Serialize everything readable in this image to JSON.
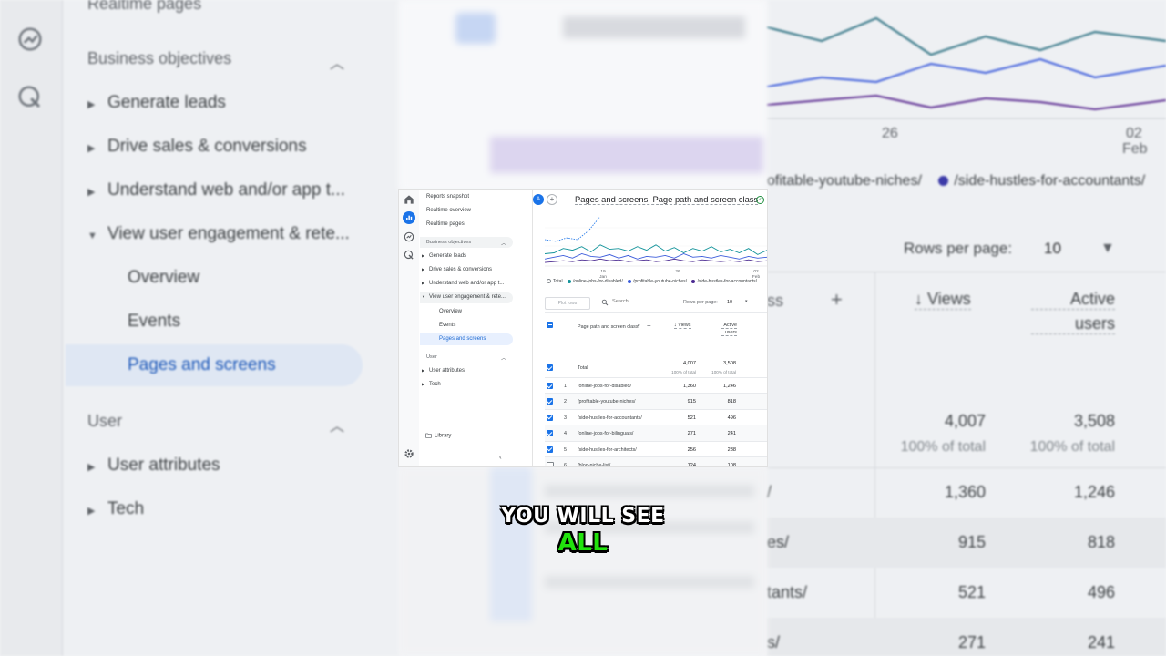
{
  "nav": {
    "top_items": [
      "Reports snapshot",
      "Realtime overview",
      "Realtime pages"
    ],
    "business_objectives": {
      "label": "Business objectives",
      "items": [
        "Generate leads",
        "Drive sales & conversions",
        "Understand web and/or app t...",
        "View user engagement & rete..."
      ],
      "subitems": [
        "Overview",
        "Events",
        "Pages and screens"
      ]
    },
    "user": {
      "label": "User",
      "items": [
        "User attributes",
        "Tech"
      ]
    },
    "library": "Library"
  },
  "bg_nav": {
    "realtime_pages": "Realtime pages",
    "business_objectives": "Business objectives",
    "items": [
      "Generate leads",
      "Drive sales & conversions",
      "Understand web and/or app t...",
      "View user engagement & rete..."
    ],
    "subitems": [
      "Overview",
      "Events",
      "Pages and screens"
    ],
    "user": "User",
    "user_items": [
      "User attributes",
      "Tech"
    ]
  },
  "header": {
    "avatar": "A",
    "plus": "+",
    "title": "Pages and screens: Page path and screen class"
  },
  "chart_data": {
    "type": "line",
    "x_ticks": [
      {
        "label": "19",
        "sub": "Jan"
      },
      {
        "label": "26",
        "sub": ""
      },
      {
        "label": "02",
        "sub": "Feb"
      }
    ],
    "series": [
      {
        "name": "Total",
        "color": "#1a73e8",
        "dashed": true,
        "values": [
          30,
          28,
          32,
          30,
          40,
          55
        ]
      },
      {
        "name": "/online-jobs-for-disabled/",
        "color": "#12939a",
        "values": [
          14,
          15,
          20,
          18,
          22,
          16,
          24,
          19,
          20,
          17,
          22,
          18,
          24,
          17,
          21,
          15,
          20,
          17,
          22,
          16,
          19,
          15,
          20,
          13,
          18
        ]
      },
      {
        "name": "/profitable-youtube-niches/",
        "color": "#3b5bdb",
        "values": [
          8,
          10,
          12,
          9,
          14,
          11,
          10,
          13,
          9,
          12,
          8,
          11,
          10,
          12,
          9,
          14,
          10,
          11,
          9,
          12,
          10,
          8,
          11,
          9,
          10
        ]
      },
      {
        "name": "/side-hustles-for-accountants/",
        "color": "#4b2a91",
        "values": [
          4,
          5,
          6,
          5,
          7,
          6,
          8,
          6,
          7,
          5,
          6,
          7,
          5,
          6,
          8,
          6,
          5,
          7,
          6,
          5,
          6,
          5,
          7,
          5,
          6
        ]
      }
    ]
  },
  "legend": [
    "Total",
    "/online-jobs-for-disabled/",
    "/profitable-youtube-niches/",
    "/side-hustles-for-accountants/"
  ],
  "toolbar": {
    "plot_rows": "Plot rows",
    "search_placeholder": "Search...",
    "rows_per_page_label": "Rows per page:",
    "rows_per_page_value": "10"
  },
  "table": {
    "col_dimension": "Page path and screen class",
    "col_views": "Views",
    "col_active_users_1": "Active",
    "col_active_users_2": "users",
    "total": {
      "label": "Total",
      "views": "4,007",
      "views_sub": "100% of total",
      "users": "3,508",
      "users_sub": "100% of total"
    },
    "rows": [
      {
        "idx": "1",
        "path": "/online-jobs-for-disabled/",
        "views": "1,360",
        "users": "1,246",
        "checked": true
      },
      {
        "idx": "2",
        "path": "/profitable-youtube-niches/",
        "views": "915",
        "users": "818",
        "checked": true
      },
      {
        "idx": "3",
        "path": "/side-hustles-for-accountants/",
        "views": "521",
        "users": "496",
        "checked": true
      },
      {
        "idx": "4",
        "path": "/online-jobs-for-bilinguals/",
        "views": "271",
        "users": "241",
        "checked": true
      },
      {
        "idx": "5",
        "path": "/side-hustles-for-architects/",
        "views": "256",
        "users": "238",
        "checked": true
      },
      {
        "idx": "6",
        "path": "/blog-niche-list/",
        "views": "124",
        "users": "108",
        "checked": false
      }
    ]
  },
  "bg_right": {
    "tick_26": "26",
    "tick_02": "02",
    "tick_feb": "Feb",
    "legend_a": "ofitable-youtube-niches/",
    "legend_b": "/side-hustles-for-accountants/",
    "rows_per_page_label": "Rows per page:",
    "rows_per_page_value": "10",
    "col_frag": "ss",
    "views": "Views",
    "active": "Active",
    "users": "users",
    "total_views": "4,007",
    "total_users": "3,508",
    "pct": "100% of total",
    "frags": [
      "/",
      "es/",
      "tants/",
      "s/"
    ],
    "views_vals": [
      "1,360",
      "915",
      "521",
      "271"
    ],
    "users_vals": [
      "1,246",
      "818",
      "496",
      "241"
    ]
  },
  "caption": {
    "line1": "YOU WILL SEE",
    "line2": "ALL"
  }
}
